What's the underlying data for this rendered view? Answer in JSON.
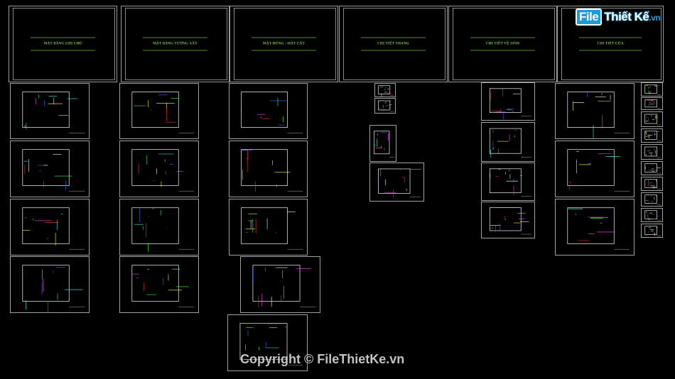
{
  "title_sheets": [
    {
      "label": "MẶT BẰNG GHI CHÚ"
    },
    {
      "label": "MẶT BẰNG TƯỜNG XÂY"
    },
    {
      "label": "MẶT ĐỨNG - MẶT CẮT"
    },
    {
      "label": "CHI TIẾT THANG"
    },
    {
      "label": "CHI TIẾT VỆ SINH"
    },
    {
      "label": "CHI TIẾT CỬA"
    }
  ],
  "watermark": {
    "logo_file": "File",
    "logo_rest": "Thiết Kế",
    "logo_tld": ".vn",
    "copyright": "Copyright © FileThietKe.vn"
  },
  "colors": {
    "background": "#000000",
    "title_text": "#7fc24a",
    "frame": "#9a9a9a",
    "logo_blue": "#1a9be0"
  }
}
